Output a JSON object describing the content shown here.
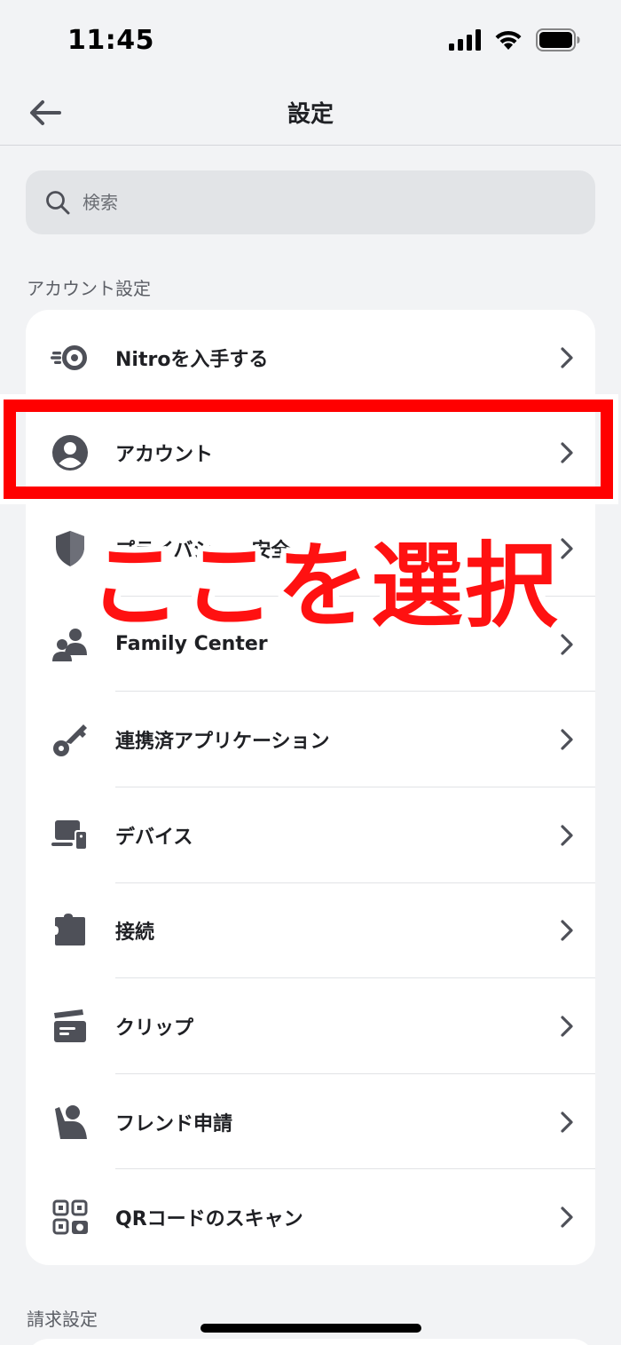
{
  "status_bar": {
    "time": "11:45"
  },
  "header": {
    "title": "設定"
  },
  "search": {
    "placeholder": "検索"
  },
  "sections": {
    "account_settings": "アカウント設定",
    "billing_settings": "請求設定"
  },
  "items": [
    {
      "label": "Nitroを入手する",
      "icon": "nitro-icon"
    },
    {
      "label": "アカウント",
      "icon": "account-icon"
    },
    {
      "label": "プライバシー・安全",
      "icon": "shield-icon"
    },
    {
      "label": "Family Center",
      "icon": "family-icon"
    },
    {
      "label": "連携済アプリケーション",
      "icon": "key-icon"
    },
    {
      "label": "デバイス",
      "icon": "devices-icon"
    },
    {
      "label": "接続",
      "icon": "puzzle-icon"
    },
    {
      "label": "クリップ",
      "icon": "clapper-icon"
    },
    {
      "label": "フレンド申請",
      "icon": "wave-person-icon"
    },
    {
      "label": "QRコードのスキャン",
      "icon": "qr-scan-icon"
    }
  ],
  "annotation": {
    "text": "ここを選択",
    "color": "#ff0000"
  },
  "colors": {
    "background": "#f2f3f5",
    "card": "#ffffff",
    "icon": "#4e5058"
  }
}
